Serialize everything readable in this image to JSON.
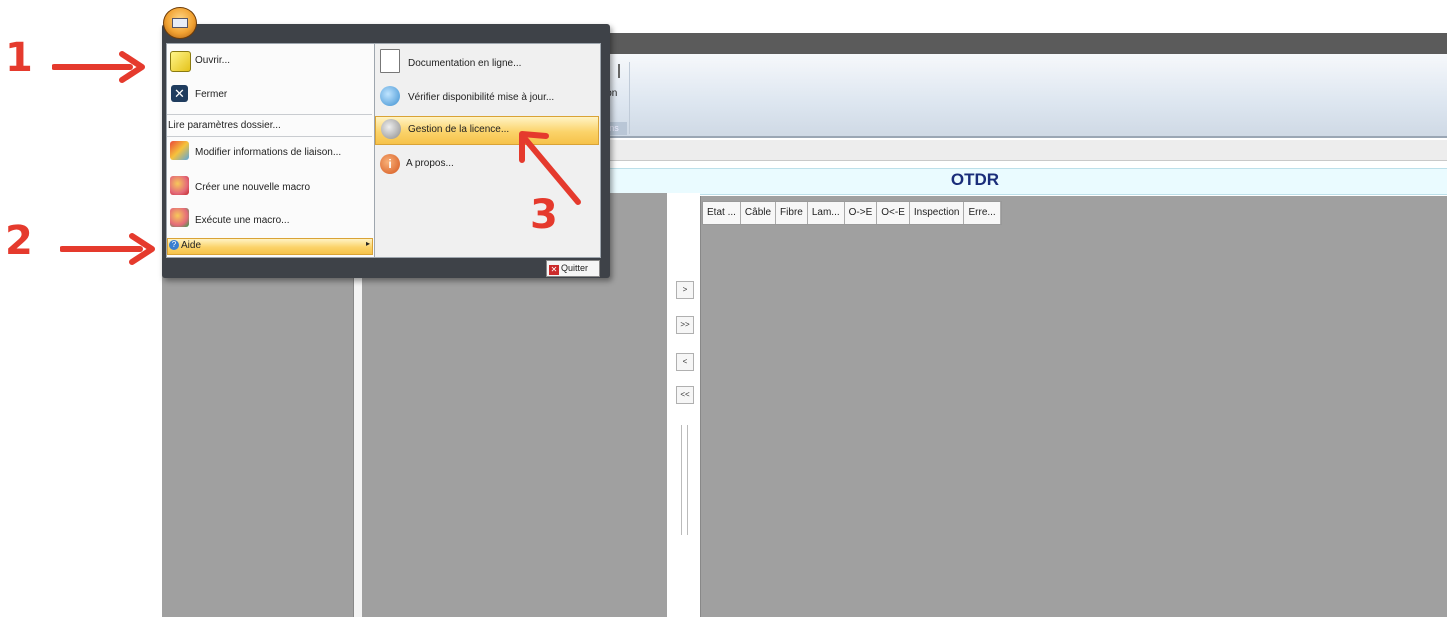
{
  "window": {
    "ribbon_button_fragment": "ion",
    "ribbon_group_fragment": "ns",
    "panel_title": "OTDR"
  },
  "table": {
    "columns": [
      "Etat ...",
      "Câble",
      "Fibre",
      "Lam...",
      "O->E",
      "O<-E",
      "Inspection",
      "Erre..."
    ]
  },
  "transfer_buttons": [
    ">",
    ">>",
    "<",
    "<<"
  ],
  "app_menu": {
    "left_items": {
      "open": "Ouvrir...",
      "close": "Fermer",
      "read_params": "Lire paramètres dossier...",
      "modify_link": "Modifier informations de liaison...",
      "create_macro": "Créer une nouvelle macro",
      "run_macro": "Exécute une macro...",
      "help": "Aide"
    },
    "right_items": {
      "online_docs": "Documentation en ligne...",
      "check_updates": "Vérifier disponibilité mise à jour...",
      "license": "Gestion de la licence...",
      "about": "A propos..."
    },
    "quit_label": "Quitter"
  },
  "annotations": {
    "step1": "1",
    "step2": "2",
    "step3": "3",
    "arrow_color": "#e53a2d"
  }
}
